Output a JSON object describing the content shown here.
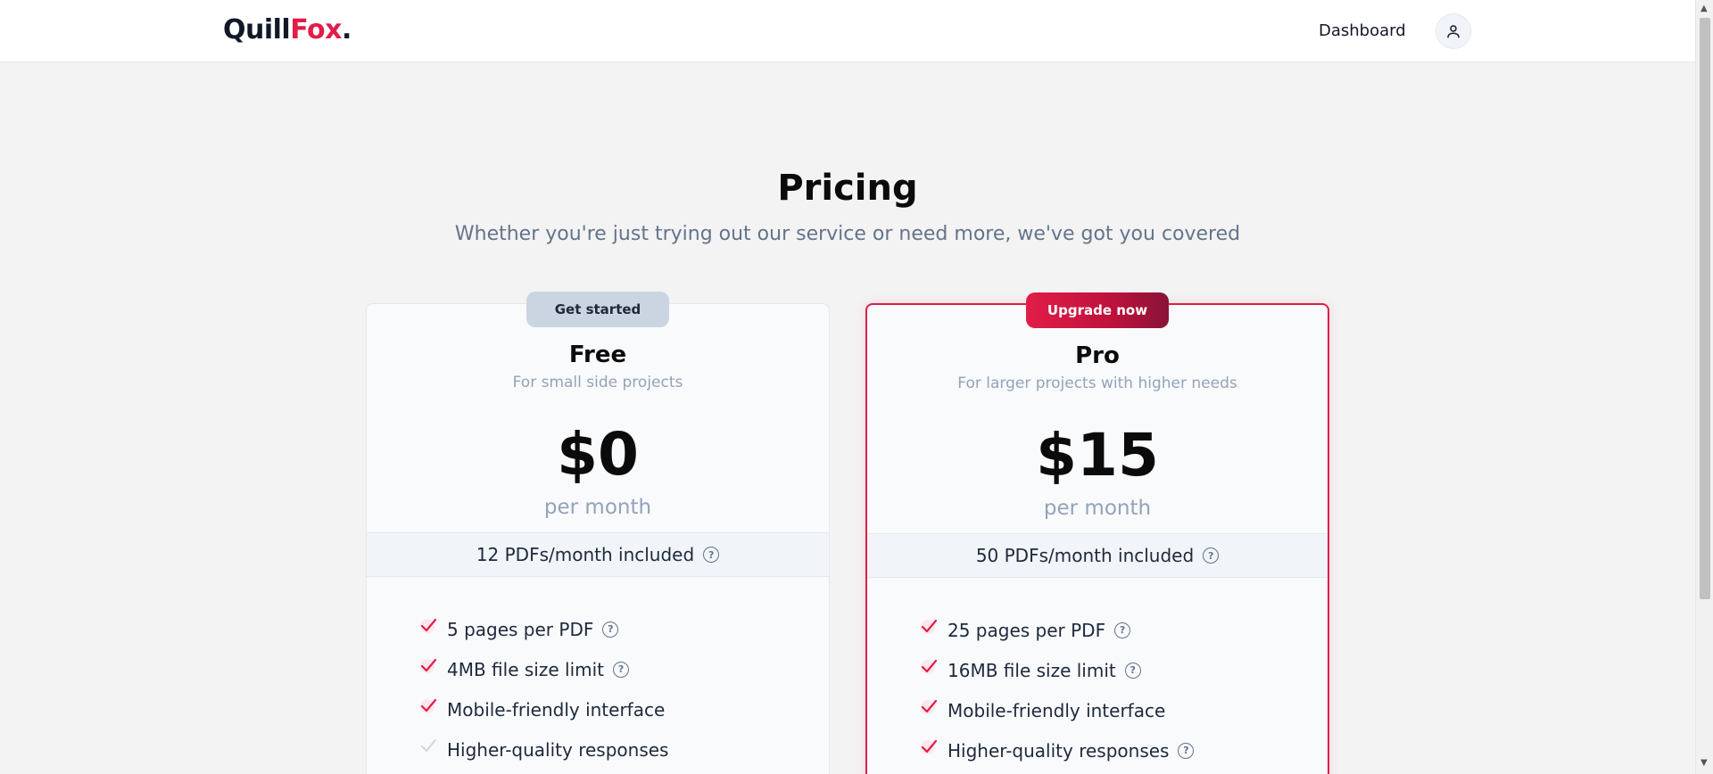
{
  "header": {
    "logo": {
      "part1": "Quill",
      "part2": "Fox",
      "part3": "."
    },
    "nav_dashboard": "Dashboard",
    "avatar_icon": "user-icon"
  },
  "colors": {
    "accent": "#e11d48",
    "muted_text": "#94a3b8",
    "badge_free_bg": "#cbd5e1"
  },
  "hero": {
    "title": "Pricing",
    "subtitle": "Whether you're just trying out our service or need more, we've got you covered"
  },
  "plans": [
    {
      "badge": "Get started",
      "name": "Free",
      "description": "For small side projects",
      "price": "$0",
      "period": "per month",
      "quota": "12 PDFs/month included",
      "features": [
        {
          "label": "5 pages per PDF",
          "included": true,
          "help": true
        },
        {
          "label": "4MB file size limit",
          "included": true,
          "help": true
        },
        {
          "label": "Mobile-friendly interface",
          "included": true,
          "help": false
        },
        {
          "label": "Higher-quality responses",
          "included": false,
          "help": false
        }
      ]
    },
    {
      "badge": "Upgrade now",
      "name": "Pro",
      "description": "For larger projects with higher needs",
      "price": "$15",
      "period": "per month",
      "quota": "50 PDFs/month included",
      "features": [
        {
          "label": "25 pages per PDF",
          "included": true,
          "help": true
        },
        {
          "label": "16MB file size limit",
          "included": true,
          "help": true
        },
        {
          "label": "Mobile-friendly interface",
          "included": true,
          "help": false
        },
        {
          "label": "Higher-quality responses",
          "included": true,
          "help": true
        }
      ]
    }
  ],
  "help_icon_glyph": "?"
}
